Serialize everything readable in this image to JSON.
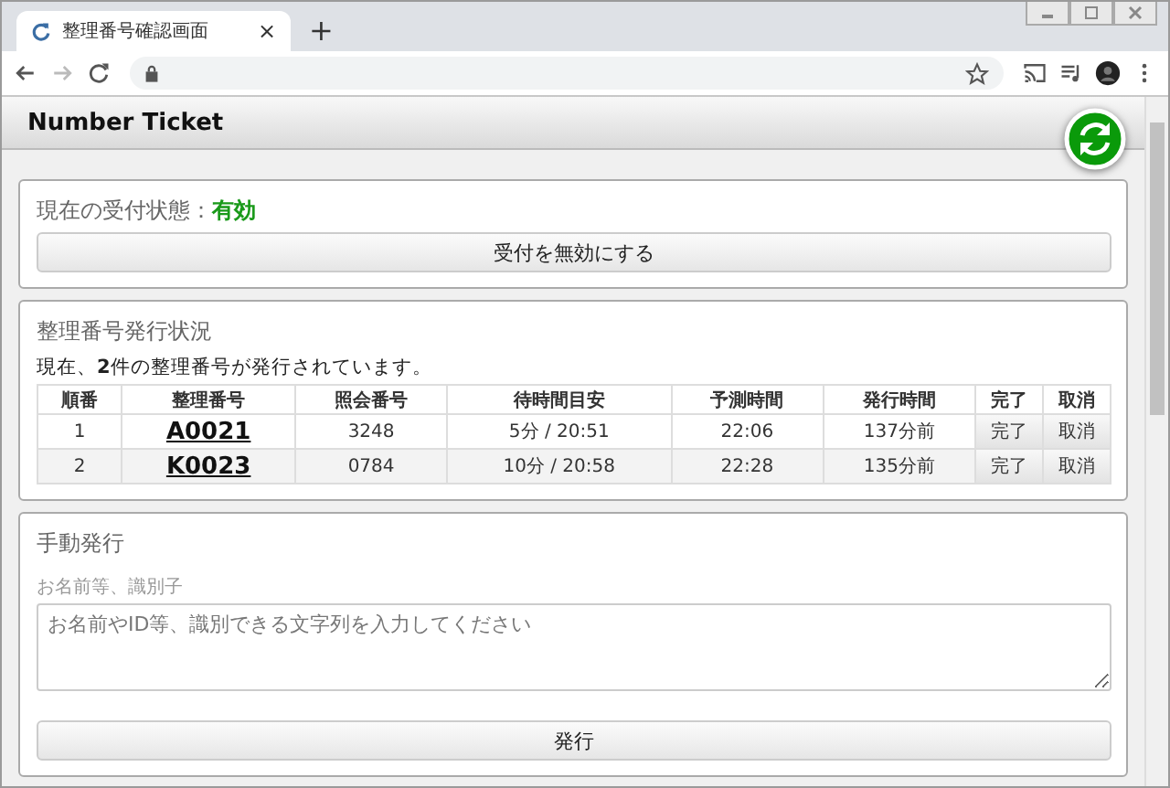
{
  "browser": {
    "tab_title": "整理番号確認画面",
    "new_tab": "+",
    "close_tab": "×"
  },
  "app": {
    "title": "Number Ticket"
  },
  "status_panel": {
    "label": "現在の受付状態：",
    "value": "有効",
    "active": true,
    "button": "受付を無効にする"
  },
  "issued_panel": {
    "title": "整理番号発行状況",
    "summary": "現在、**2**件の整理番号が発行されています。",
    "table": {
      "columns": [
        "順番",
        "整理番号",
        "照会番号",
        "待時間目安",
        "予測時間",
        "発行時間",
        "完了",
        "取消"
      ],
      "rows": [
        {
          "order": "1",
          "ticket": "A0021",
          "ref": "3248",
          "wait": "5分 / 20:51",
          "predicted": "22:06",
          "issued": "137分前",
          "complete": "完了",
          "cancel": "取消"
        },
        {
          "order": "2",
          "ticket": "K0023",
          "ref": "0784",
          "wait": "10分 / 20:58",
          "predicted": "22:28",
          "issued": "135分前",
          "complete": "完了",
          "cancel": "取消"
        }
      ]
    }
  },
  "manual_panel": {
    "title": "手動発行",
    "field_label": "お名前等、識別子",
    "placeholder": "お名前やID等、識別できる文字列を入力してください",
    "button": "発行"
  }
}
